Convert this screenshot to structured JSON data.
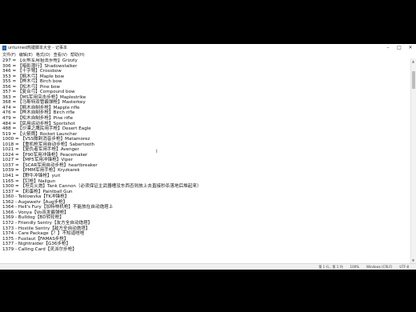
{
  "window": {
    "title": "untunned热键脚本大全 - 记事本"
  },
  "menu": [
    "文件(F)",
    "编辑(E)",
    "格式(O)",
    "查看(V)",
    "帮助(H)"
  ],
  "lines": [
    "297 = 【灰熊军用狙击步枪】Grizzly",
    "306 = 【暗影潜行】Shadowstalker",
    "346 = 【十字弩】Crossbow",
    "353 = 【枫木弓】Maple bow",
    "355 = 【桦木弓】Birch bow",
    "356 = 【松木弓】Pine bow",
    "357 = 【复合弓】Compound bow",
    "363 = 【MS军用突击步枪】Maplestrike",
    "368 = 【马斯特双管霰弹枪】Masterkey",
    "474 = 【枫木自制步枪】Mapple rifle",
    "476 = 【桦木自制步枪】Birch rifle",
    "479 = 【松木自制步枪】Pine rifle",
    "484 = 【民用运动步枪】Sportshot",
    "488 = 【沙漠之鹰民用手枪】Desert Eagle",
    "519 = 【火箭筒】Rocket Launcher",
    "1000 = 【VSS微剌消音步枪】Matamorez",
    "1018 = 【重机枪军用自动步枪】Sabertooth",
    "1021 = 【复仇者军用手枪】Avenger",
    "1024 = 【P90军用冲锋枪】Peacemaker",
    "1027 = 【MP5军用冲锋枪】Viper",
    "1037 = 【SCAR军用自动步枪】heartbreaker",
    "1039 = 【PMM军用手枪】Kryzkarek",
    "1041 = 【野牛冲锋枪】yuri",
    "1165 = 【钉枪】Nailgun",
    "1300 = 【坦克火炮】Tank Cannon（必须保证主武器槽没东西否则放上去直接秒杀落地后堆起来）",
    "1337 = 【彩蛋枪】Paintball Gun",
    "1360 - Teklowvka【TK冲锋枪】",
    "1362 - Augewehr【Aug步枪】",
    "1364 - Hell's Fury【加特林机枪】不能放在自动炮塔上",
    "1366 - Vonya【Vo连发霰弹枪】",
    "1369 - Bulldog【BD转轮枪】",
    "1372 - Friendly Sentry【友方全自动炮塔】",
    "1373 - Hostile Sentry【敌方全自动炮塔】",
    "1374 - Care Package【？】不知道啥啥",
    "1375 - Fusilaut【FAMAS步枪】",
    "1377 - Nightraider【G36步枪】",
    "1379 - Calling Card【灵派尔步枪】"
  ],
  "status": {
    "position": "第 1 行，第 1 列",
    "zoom": "100%",
    "line_ending": "Windows (CRLF)",
    "encoding": "UTF-8"
  },
  "icons": {
    "app": "notepad-icon",
    "minimize": "minimize-icon",
    "maximize": "maximize-icon",
    "close": "close-icon"
  }
}
